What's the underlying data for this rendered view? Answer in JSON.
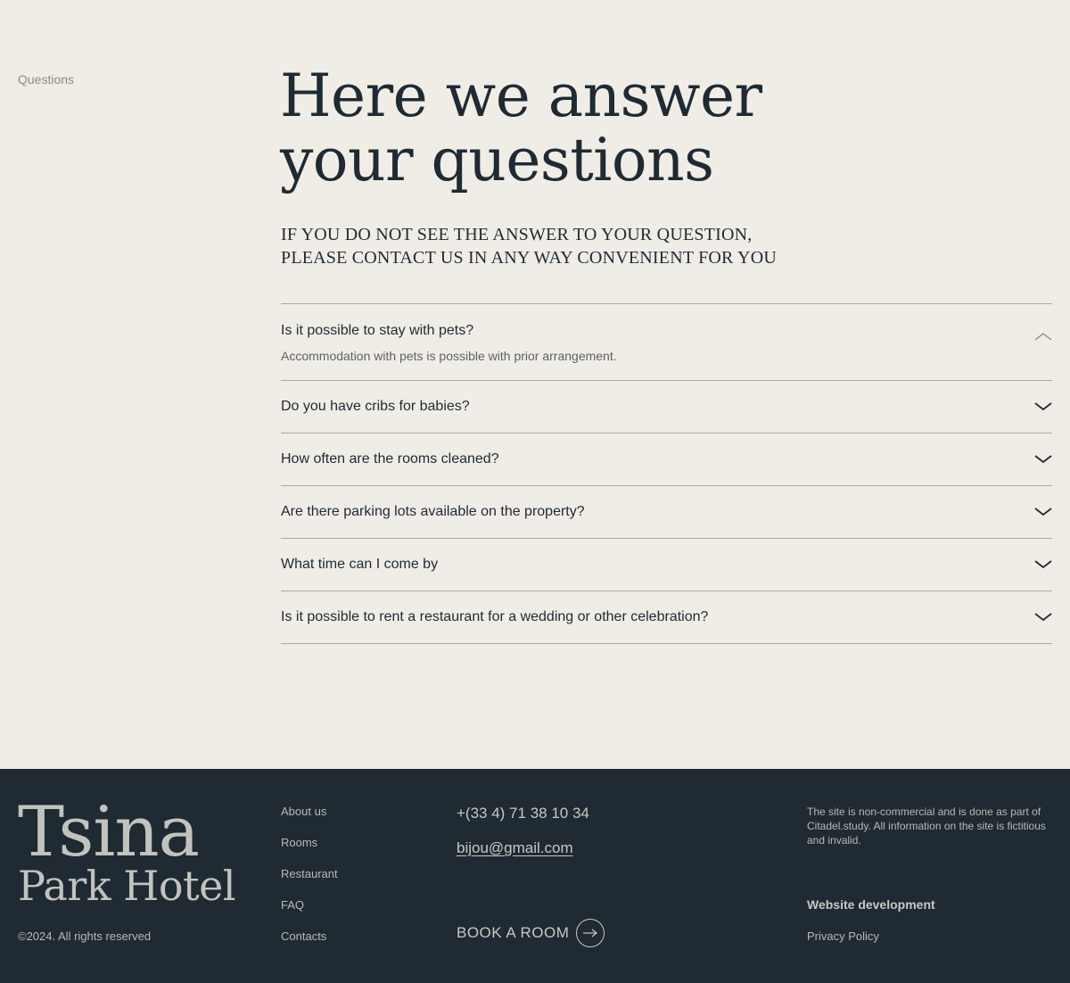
{
  "section_label": "Questions",
  "headline": {
    "line1": "Here we answer",
    "line2": "your questions"
  },
  "subhead": {
    "line1": "IF YOU DO NOT SEE THE ANSWER TO YOUR QUESTION,",
    "line2": "PLEASE CONTACT US IN ANY WAY CONVENIENT FOR YOU"
  },
  "faq": [
    {
      "question": "Is it possible to stay with pets?",
      "answer": "Accommodation with pets is possible with prior arrangement.",
      "open": true
    },
    {
      "question": "Do you have cribs for babies?",
      "open": false
    },
    {
      "question": "How often are the rooms cleaned?",
      "open": false
    },
    {
      "question": "Are there parking lots available on the property?",
      "open": false
    },
    {
      "question": "What time can I come by",
      "open": false
    },
    {
      "question": "Is it possible to rent a restaurant for a wedding or other celebration?",
      "open": false
    }
  ],
  "footer": {
    "logo": {
      "line1": "Tsina",
      "line2": "Park Hotel"
    },
    "copyright": "©2024. All rights reserved",
    "nav": [
      "About us",
      "Rooms",
      "Restaurant",
      "FAQ",
      "Contacts"
    ],
    "phone": "+(33 4) 71 38 10 34",
    "email": "bijou@gmail.com",
    "book_label": "BOOK A ROOM",
    "disclaimer": "The site is non-commercial and is done as part of Citadel.study. All information on the site is fictitious and invalid.",
    "web_dev": "Website development",
    "privacy": "Privacy Policy"
  },
  "colors": {
    "background": "#efede6",
    "footer": "#1f2a33",
    "text": "#1f2a33",
    "divider": "#a9aaa6"
  }
}
